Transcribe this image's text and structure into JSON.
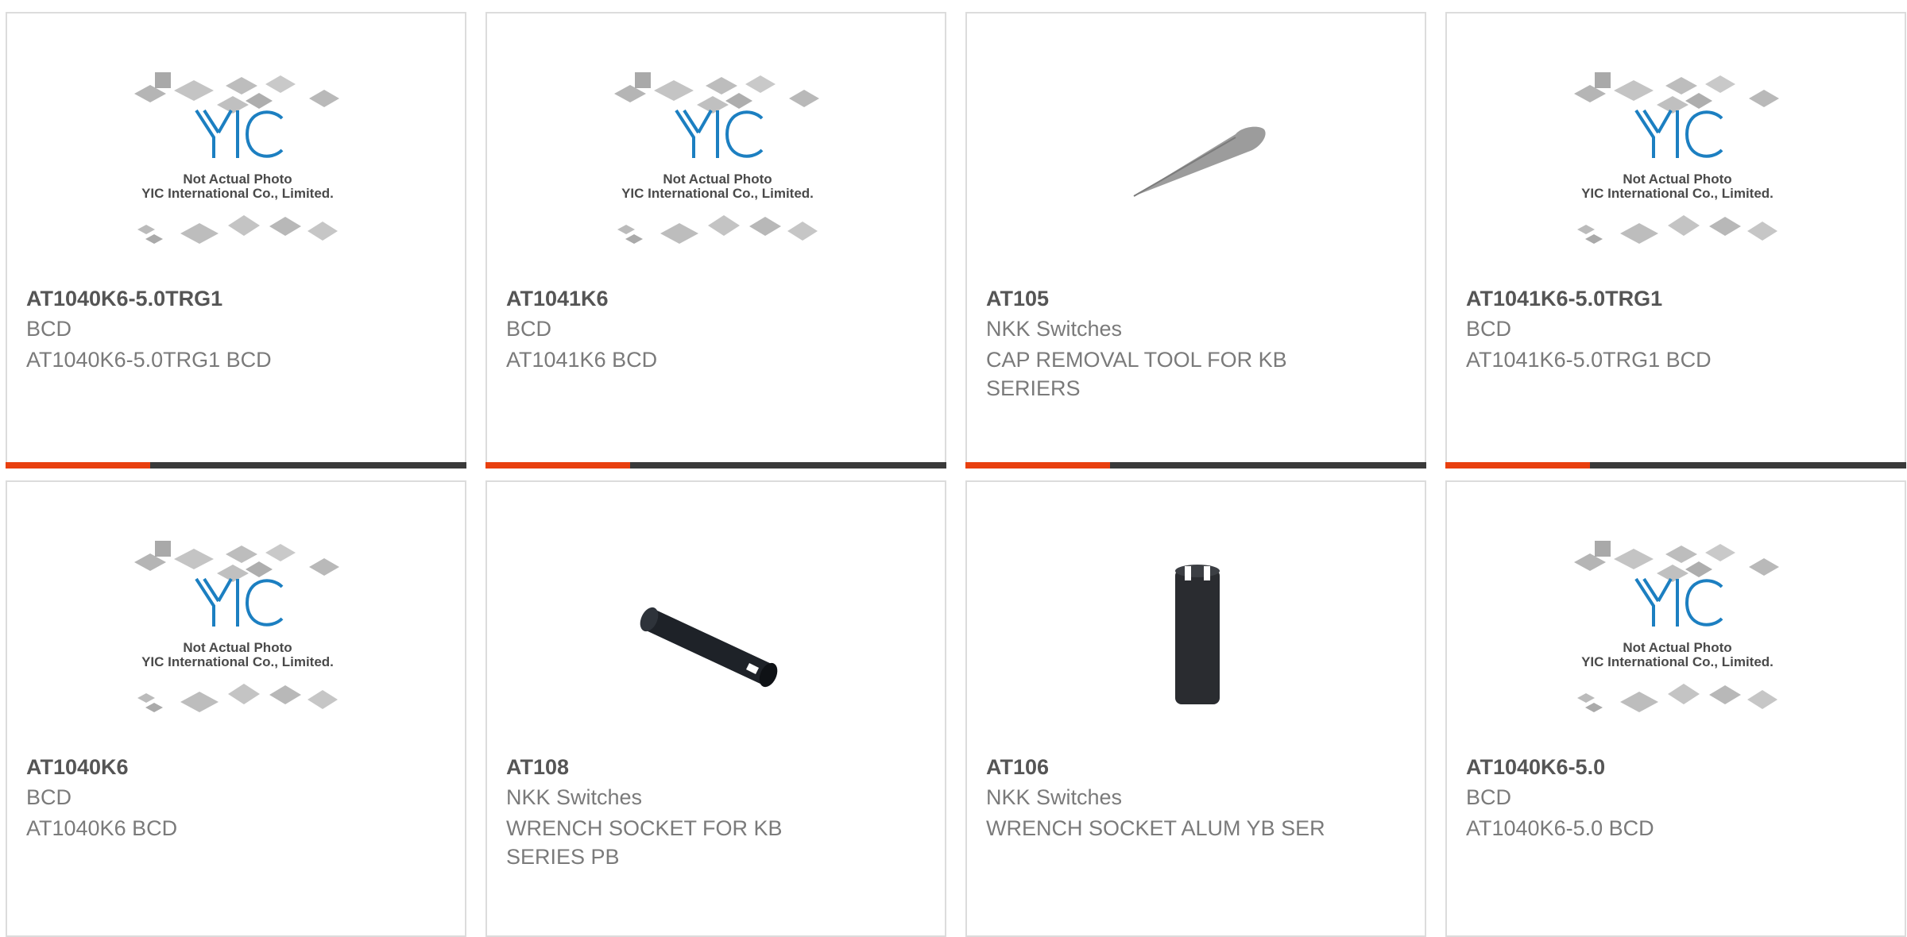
{
  "colors": {
    "accent": "#e8400f",
    "bar": "#3a3a3a",
    "logo": "#1c7fc1"
  },
  "placeholder": {
    "line1": "Not Actual Photo",
    "line2": "YIC International Co., Limited."
  },
  "products": [
    {
      "part": "AT1040K6-5.0TRG1",
      "manufacturer": "BCD",
      "description": "AT1040K6-5.0TRG1 BCD",
      "image": "yic-placeholder"
    },
    {
      "part": "AT1041K6",
      "manufacturer": "BCD",
      "description": "AT1041K6 BCD",
      "image": "yic-placeholder"
    },
    {
      "part": "AT105",
      "manufacturer": "NKK Switches",
      "description": "CAP REMOVAL TOOL FOR KB SERIERS",
      "image": "cap-removal-tool"
    },
    {
      "part": "AT1041K6-5.0TRG1",
      "manufacturer": "BCD",
      "description": "AT1041K6-5.0TRG1 BCD",
      "image": "yic-placeholder"
    },
    {
      "part": "AT1040K6",
      "manufacturer": "BCD",
      "description": "AT1040K6 BCD",
      "image": "yic-placeholder"
    },
    {
      "part": "AT108",
      "manufacturer": "NKK Switches",
      "description": "WRENCH SOCKET FOR KB SERIES PB",
      "image": "wrench-socket-tube"
    },
    {
      "part": "AT106",
      "manufacturer": "NKK Switches",
      "description": "WRENCH SOCKET ALUM YB SER",
      "image": "wrench-socket-upright"
    },
    {
      "part": "AT1040K6-5.0",
      "manufacturer": "BCD",
      "description": "AT1040K6-5.0 BCD",
      "image": "yic-placeholder"
    }
  ]
}
